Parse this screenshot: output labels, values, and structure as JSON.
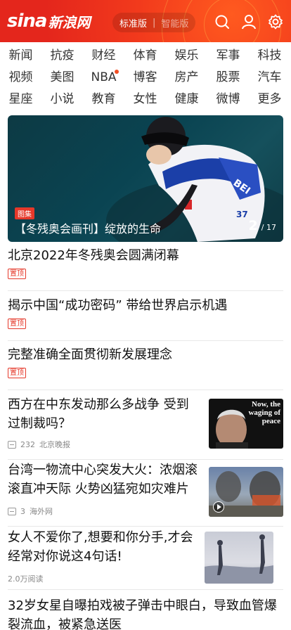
{
  "header": {
    "logo_latin": "sina",
    "logo_cn": "新浪网",
    "version_active": "标准版",
    "version_alt": "智能版",
    "icons": [
      "search-icon",
      "user-icon",
      "settings-icon"
    ],
    "brand_color": "#e4261c"
  },
  "nav": {
    "rows": [
      [
        "新闻",
        "抗疫",
        "财经",
        "体育",
        "娱乐",
        "军事",
        "科技"
      ],
      [
        "视频",
        "美图",
        "NBA",
        "博客",
        "房产",
        "股票",
        "汽车"
      ],
      [
        "星座",
        "小说",
        "教育",
        "女性",
        "健康",
        "微博",
        "更多"
      ]
    ],
    "dot_item": "NBA"
  },
  "hero": {
    "tag": "图集",
    "title": "【冬残奥会画刊】绽放的生命",
    "current": "2",
    "total": "/ 17"
  },
  "articles": [
    {
      "title": "北京2022年冬残奥会圆满闭幕",
      "pin": "置顶"
    },
    {
      "title": "揭示中国“成功密码” 带给世界启示机遇",
      "pin": "置顶"
    },
    {
      "title": "完整准确全面贯彻新发展理念",
      "pin": "置顶"
    },
    {
      "title": "西方在中东发动那么多战争 受到过制裁吗？",
      "comments": "232",
      "source": "北京晚报",
      "thumb_text": "Now, the waging of peace"
    },
    {
      "title": "台湾一物流中心突发大火：浓烟滚滚直冲天际 火势凶猛宛如灾难片",
      "comments": "3",
      "source": "海外网",
      "thumb_icon": "play-icon"
    },
    {
      "title": "女人不爱你了,想要和你分手,才会经常对你说这4句话!",
      "reads": "2.0万阅读"
    },
    {
      "title": "32岁女星自曝拍戏被子弹击中眼白，导致血管爆裂流血，被紧急送医"
    }
  ]
}
